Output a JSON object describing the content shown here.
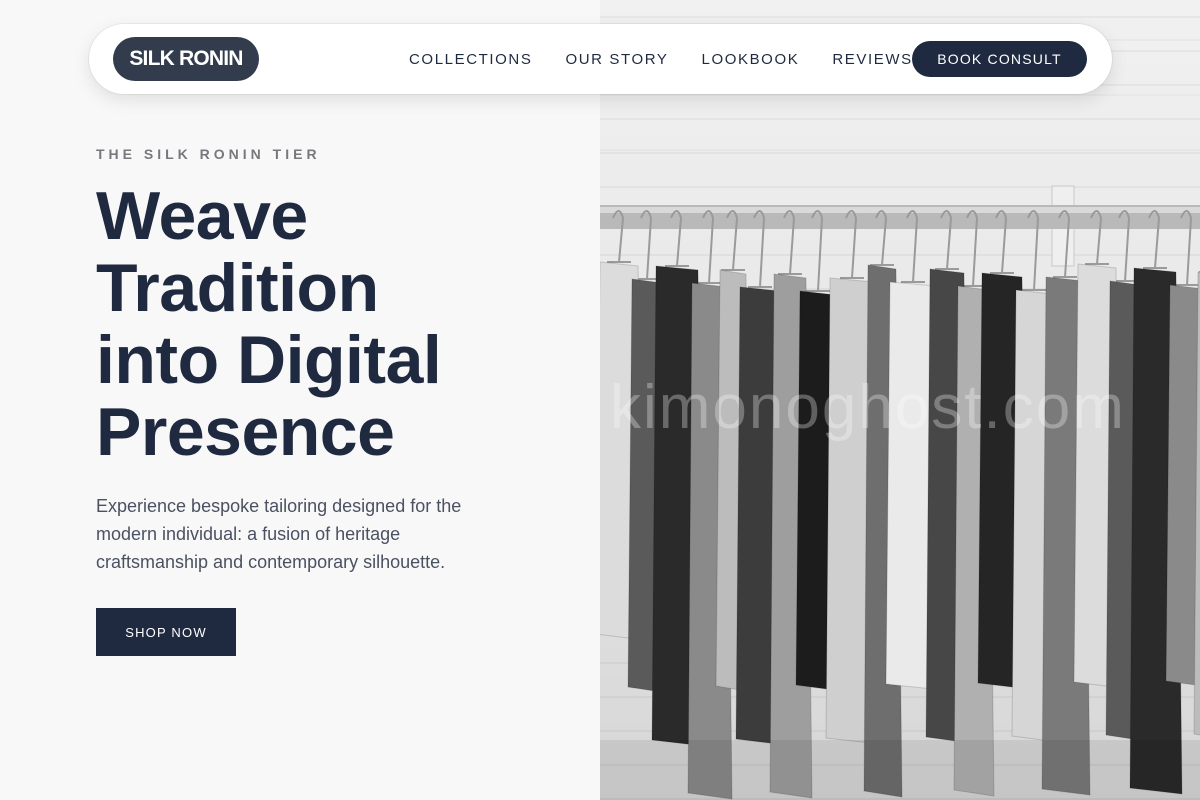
{
  "nav": {
    "brand": "SILK RONIN",
    "links": [
      {
        "label": "COLLECTIONS"
      },
      {
        "label": "OUR STORY"
      },
      {
        "label": "LOOKBOOK"
      },
      {
        "label": "REVIEWS"
      }
    ],
    "cta": "BOOK CONSULT"
  },
  "hero": {
    "eyebrow": "THE SILK RONIN TIER",
    "headline_lines": [
      "Weave",
      "Tradition",
      "into Digital",
      "Presence"
    ],
    "description": "Experience bespoke tailoring designed for the modern individual: a fusion of heritage craftsmanship and contemporary silhouette.",
    "cta": "SHOP NOW",
    "image": {
      "subject": "clothing-rack-photo",
      "watermark": "kimonoghost.com"
    }
  },
  "colors": {
    "navy": "#1f2a40",
    "logo_bg": "#333c4c",
    "page_bg": "#f8f8f8",
    "eyebrow": "#76787d",
    "body_text": "#4b5161"
  }
}
